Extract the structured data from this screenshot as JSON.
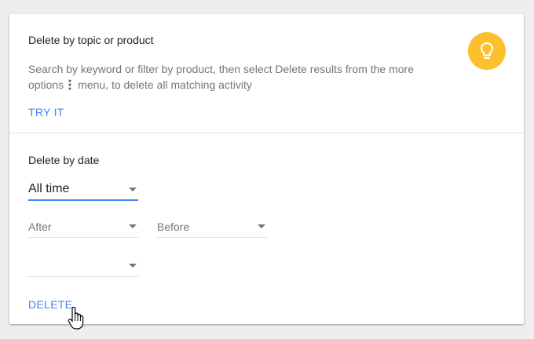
{
  "topic_section": {
    "title": "Delete by topic or product",
    "description_part1": "Search by keyword or filter by product, then select Delete results from the more",
    "description_part2_before_icon": "options",
    "description_part2_after_icon": "menu, to delete all matching activity",
    "try_it_label": "TRY IT",
    "icon": "lightbulb-icon",
    "accent_color": "#fbc02d"
  },
  "date_section": {
    "title": "Delete by date",
    "range_select": {
      "value": "All time"
    },
    "after_select": {
      "placeholder": "After"
    },
    "before_select": {
      "placeholder": "Before"
    },
    "product_select": {
      "value": ""
    },
    "delete_label": "DELETE",
    "link_color": "#4285f4"
  }
}
